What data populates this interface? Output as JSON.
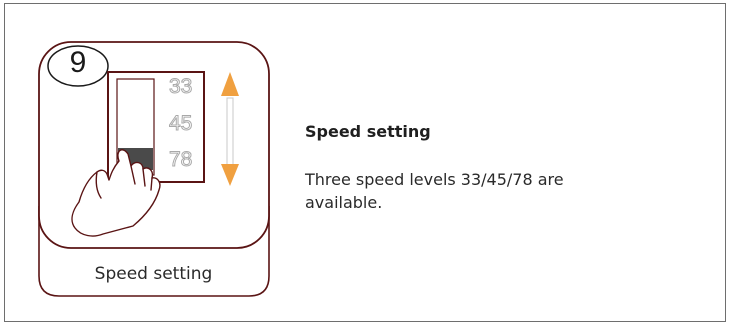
{
  "illustration": {
    "step_number": "9",
    "caption": "Speed setting",
    "speeds": [
      "33",
      "45",
      "78"
    ],
    "selected_speed": "78",
    "colors": {
      "frame": "#5a1414",
      "arrow": "#f0a040",
      "switch_knob": "#4a4a4a"
    }
  },
  "content": {
    "title": "Speed setting",
    "description": "Three speed levels 33/45/78 are available."
  }
}
